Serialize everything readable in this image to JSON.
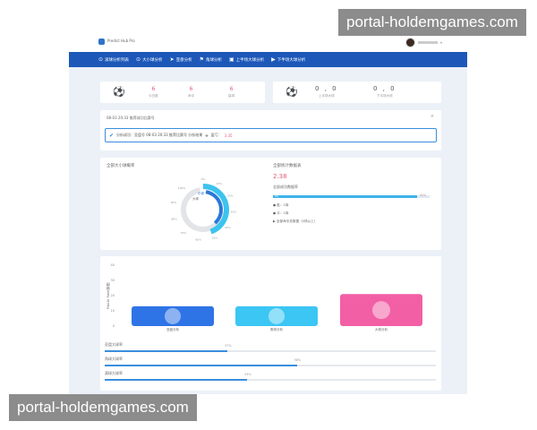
{
  "watermark": "portal-holdemgames.com",
  "header": {
    "logo_text": "Predict Hub Pro",
    "user_caret": "▾"
  },
  "nav": [
    {
      "icon": "⊙",
      "label": "滚球分析列表",
      "name": "nav-rolling-list"
    },
    {
      "icon": "⊙",
      "label": "大小球分析",
      "name": "nav-over-under"
    },
    {
      "icon": "➤",
      "label": "亚盘分析",
      "name": "nav-asian"
    },
    {
      "icon": "⚑",
      "label": "角球分析",
      "name": "nav-corner"
    },
    {
      "icon": "▣",
      "label": "上半场大球分析",
      "name": "nav-first-half"
    },
    {
      "icon": "▶",
      "label": "下半场大球分析",
      "name": "nav-second-half"
    }
  ],
  "stats1": {
    "icon": "ball-icon",
    "items": [
      {
        "value": "6",
        "label": "今日数"
      },
      {
        "value": "6",
        "label": "命中"
      },
      {
        "value": "6",
        "label": "赢球"
      }
    ]
  },
  "stats2": {
    "icon": "balls-icon",
    "items": [
      {
        "value": "0 , 0",
        "label": "上半场大球"
      },
      {
        "value": "0 , 0",
        "label": "下半场大球"
      }
    ]
  },
  "alert": {
    "header": "08-03 20:33 推荐成功比赛号",
    "close": "×",
    "prefix": "分析成功：亚盘号 08-03 20:33 推荐比赛号 分析结果",
    "tail_label": "盈亏：",
    "tail_value": "3.35"
  },
  "donut": {
    "title": "全部大小球概率",
    "center_label": "大球",
    "legend_small": "小球",
    "value_fraction": 0.62,
    "tick_labels": [
      "0%",
      "10%",
      "20%",
      "30%",
      "40%",
      "50%",
      "60%",
      "70%",
      "80%",
      "90%",
      "100%"
    ]
  },
  "summary": {
    "title": "全部统计数据表",
    "value": "2.38",
    "rate_title": "全部成功数据率",
    "rate_inline": "0%",
    "rate_value": 0.92,
    "rate_label": "92%",
    "legend": [
      "胜：1场",
      "平：1场",
      "全部命中总数据（0场以上）"
    ]
  },
  "bar_chart": {
    "ylabel": "Max1b Rate(数据)",
    "yticks": [
      "40",
      "30",
      "20",
      "10",
      "0"
    ],
    "ylim": [
      0,
      40
    ],
    "colors": [
      "#2f74e6",
      "#3bc6f4",
      "#f25fa5"
    ],
    "categories": [
      "亚盘分析",
      "角球分析",
      "大球分析"
    ],
    "values": [
      13,
      13,
      21
    ]
  },
  "rates": [
    {
      "label": "亚盘大球率",
      "pct": "37%",
      "value": 0.37
    },
    {
      "label": "角球大球率",
      "pct": "58%",
      "value": 0.58
    },
    {
      "label": "滚球大球率",
      "pct": "43%",
      "value": 0.43
    }
  ]
}
